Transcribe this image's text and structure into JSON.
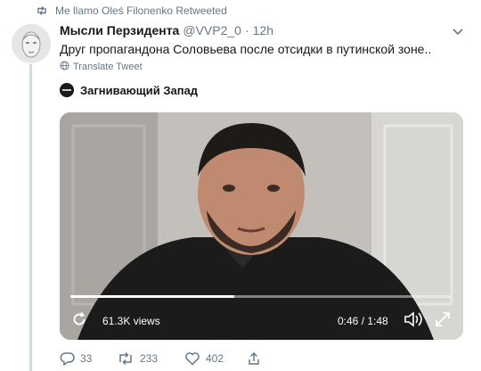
{
  "retweeted_by": "Me llamo Oleś Filonenko Retweeted",
  "tweet": {
    "author_name": "Мысли Перзидента",
    "handle": "@VVP2_0",
    "separator": "·",
    "time": "12h",
    "text": "Друг пропагандона Соловьева после отсидки в путинской зоне..",
    "translate_label": "Translate Tweet"
  },
  "media": {
    "source_name": "Загнивающий Запад",
    "views": "61.3K views",
    "time_display": "0:46 / 1:48",
    "progress_fraction": 0.43
  },
  "actions": {
    "replies": "33",
    "retweets": "233",
    "likes": "402"
  },
  "colors": {
    "accent": "#1da1f2",
    "muted": "#657786",
    "thread_line": "#c7e4cc"
  },
  "icons": [
    "retweet-icon",
    "chevron-down-icon",
    "globe-icon",
    "replay-icon",
    "volume-icon",
    "fullscreen-icon",
    "reply-icon",
    "like-icon",
    "share-icon"
  ]
}
